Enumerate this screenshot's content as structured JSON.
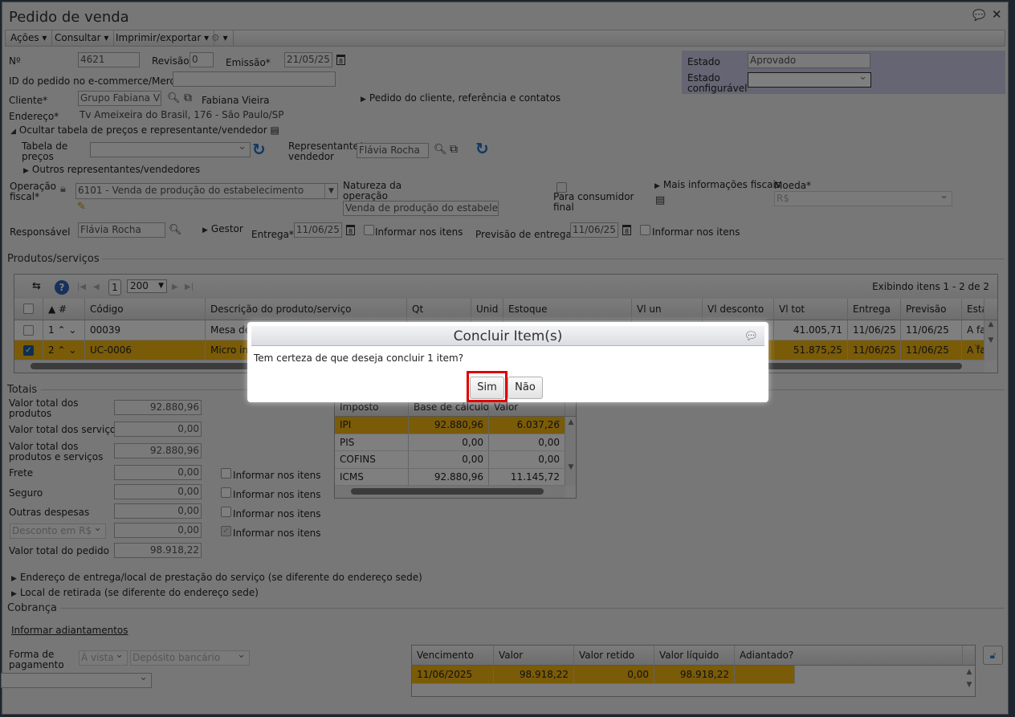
{
  "window": {
    "title": "Pedido de venda"
  },
  "toolbar": {
    "acoes": "Ações",
    "consultar": "Consultar",
    "imprimir": "Imprimir/exportar"
  },
  "header": {
    "numero_label": "Nº",
    "numero": "4621",
    "revisao_label": "Revisão",
    "revisao": "0",
    "emissao_label": "Emissão*",
    "emissao": "21/05/25",
    "id_ecommerce_label": "ID do pedido no e-commerce/Mercos",
    "id_ecommerce": "",
    "cliente_label": "Cliente*",
    "cliente": "Grupo Fabiana Vieira",
    "cliente_contato": "Fabiana Vieira",
    "pedido_cliente_link": "Pedido do cliente, referência e contatos",
    "endereco_label": "Endereço*",
    "endereco": "Tv Ameixeira do Brasil, 176 - São Paulo/SP",
    "ocultar_tabela": "Ocultar tabela de preços e representante/vendedor",
    "tabela_precos_label1": "Tabela de",
    "tabela_precos_label2": "preços",
    "tabela_precos": "",
    "representante_label1": "Representante/",
    "representante_label2": "vendedor",
    "representante": "Flávia Rocha",
    "outros_representantes": "Outros representantes/vendedores",
    "operacao_label1": "Operação",
    "operacao_label2": "fiscal*",
    "operacao": "6101 - Venda de produção do estabelecimento",
    "natureza_label1": "Natureza da",
    "natureza_label2": "operação",
    "natureza": "Venda de produção do estabelecimento",
    "consumidor_label1": "Para consumidor",
    "consumidor_label2": "final",
    "mais_fiscais": "Mais informações fiscais",
    "moeda_label": "Moeda*",
    "moeda": "R$",
    "estado_label": "Estado",
    "estado": "Aprovado",
    "estado_conf_label1": "Estado",
    "estado_conf_label2": "configurável",
    "estado_conf": "",
    "responsavel_label": "Responsável",
    "responsavel": "Flávia Rocha",
    "gestor": "Gestor",
    "entrega_label": "Entrega*",
    "entrega": "11/06/25",
    "informar_itens": "Informar nos itens",
    "previsao_label": "Previsão de entrega*",
    "previsao": "11/06/25"
  },
  "produtos": {
    "section": "Produtos/serviços",
    "page": "1",
    "page_size": "200",
    "exibindo": "Exibindo itens 1 - 2 de 2",
    "columns": [
      "",
      "▲ #",
      "Código",
      "Descrição do produto/serviço",
      "Qt",
      "Unid",
      "Estoque",
      "Vl un",
      "Vl desconto",
      "Vl tot",
      "Entrega",
      "Previsão",
      "Esta"
    ],
    "rows": [
      {
        "num": "1",
        "codigo": "00039",
        "descricao": "Mesa de",
        "vltot": "41.005,71",
        "entrega": "11/06/25",
        "previsao": "11/06/25",
        "estado": "A fa",
        "checked": false
      },
      {
        "num": "2",
        "codigo": "UC-0006",
        "descricao": "Micro in",
        "vltot": "51.875,25",
        "entrega": "11/06/25",
        "previsao": "11/06/25",
        "estado": "A fa",
        "checked": true
      }
    ]
  },
  "totais": {
    "section": "Totais",
    "prod_label1": "Valor total dos",
    "prod_label2": "produtos",
    "prod": "92.880,96",
    "serv_label": "Valor total dos serviços",
    "serv": "0,00",
    "ps_label1": "Valor total dos",
    "ps_label2": "produtos e serviços",
    "ps": "92.880,96",
    "frete_label": "Frete",
    "frete": "0,00",
    "seguro_label": "Seguro",
    "seguro": "0,00",
    "outras_label": "Outras despesas",
    "outras": "0,00",
    "desconto_tipo": "Desconto em R$",
    "desconto": "0,00",
    "pedido_label": "Valor total do pedido",
    "pedido": "98.918,22",
    "informar_itens": "Informar nos itens"
  },
  "impostos": {
    "columns": [
      "Imposto",
      "Base de cálculo",
      "Valor"
    ],
    "rows": [
      [
        "IPI",
        "92.880,96",
        "6.037,26"
      ],
      [
        "PIS",
        "0,00",
        "0,00"
      ],
      [
        "COFINS",
        "0,00",
        "0,00"
      ],
      [
        "ICMS",
        "92.880,96",
        "11.145,72"
      ]
    ]
  },
  "links": {
    "endereco_entrega": "Endereço de entrega/local de prestação do serviço (se diferente do endereço sede)",
    "local_retirada": "Local de retirada (se diferente do endereço sede)"
  },
  "cobranca": {
    "section": "Cobrança",
    "adiantamentos": "Informar adiantamentos",
    "forma_label1": "Forma de",
    "forma_label2": "pagamento",
    "condicao": "À vista",
    "meio": "Depósito bancário",
    "columns": [
      "Vencimento",
      "Valor",
      "Valor retido",
      "Valor líquido",
      "Adiantado?"
    ],
    "rows": [
      [
        "11/06/2025",
        "98.918,22",
        "0,00",
        "98.918,22",
        ""
      ]
    ]
  },
  "dialog": {
    "title": "Concluir Item(s)",
    "message": "Tem certeza de que deseja concluir 1 item?",
    "yes": "Sim",
    "no": "Não"
  }
}
